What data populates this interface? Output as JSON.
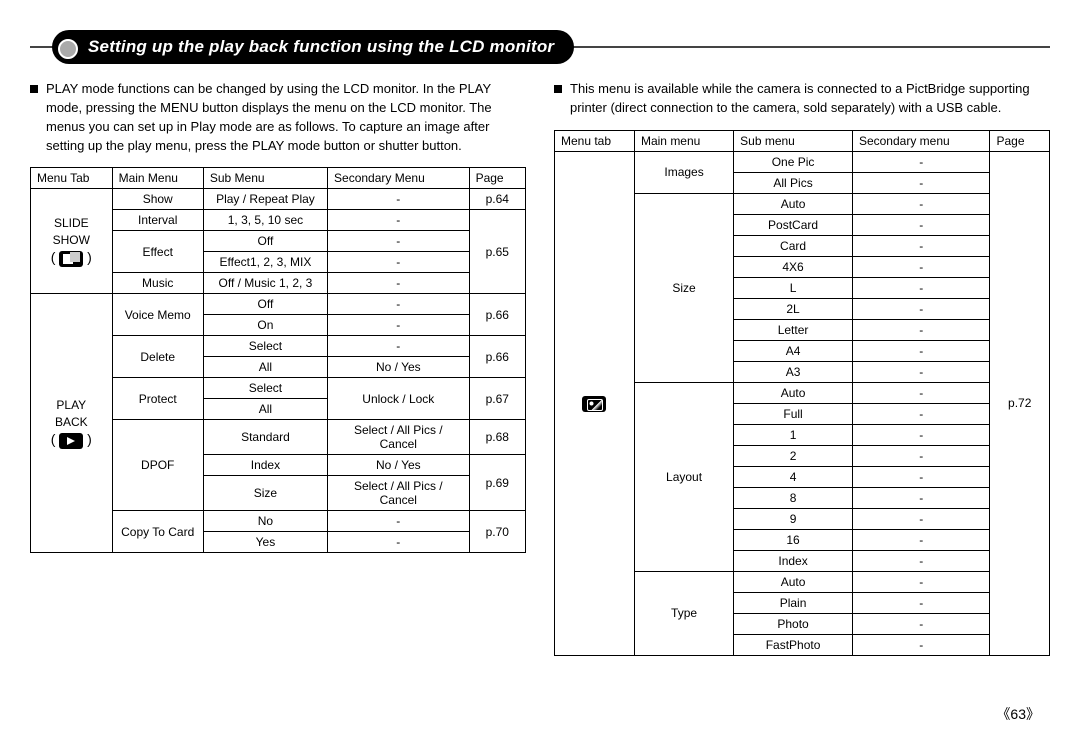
{
  "banner": {
    "title": "Setting up the play back function using the LCD monitor"
  },
  "left": {
    "para": "PLAY mode functions can be changed by using the LCD monitor. In the PLAY mode, pressing the MENU button displays the menu on the LCD monitor. The menus you can set up in Play mode are as follows. To capture an image after setting up the play menu, press the PLAY mode button or shutter button.",
    "headers": [
      "Menu Tab",
      "Main Menu",
      "Sub Menu",
      "Secondary Menu",
      "Page"
    ],
    "groups": [
      {
        "tab": "SLIDE SHOW",
        "icon": "slide",
        "rows": [
          {
            "main": "Show",
            "sub": "Play / Repeat Play",
            "sec": "-",
            "page": "p.64"
          },
          {
            "main": "Interval",
            "sub": "1, 3, 5, 10 sec",
            "sec": "-",
            "page": ""
          },
          {
            "main": "Effect",
            "sub": "Off",
            "sec": "-",
            "page": "p.65"
          },
          {
            "main": "",
            "sub": "Effect1, 2, 3, MIX",
            "sec": "-",
            "page": ""
          },
          {
            "main": "Music",
            "sub": "Off / Music 1, 2, 3",
            "sec": "-",
            "page": ""
          }
        ]
      },
      {
        "tab": "PLAY BACK",
        "icon": "play",
        "rows": [
          {
            "main": "Voice Memo",
            "sub": "Off",
            "sec": "-",
            "page": "p.66"
          },
          {
            "main": "",
            "sub": "On",
            "sec": "-",
            "page": ""
          },
          {
            "main": "Delete",
            "sub": "Select",
            "sec": "-",
            "page": "p.66"
          },
          {
            "main": "",
            "sub": "All",
            "sec": "No / Yes",
            "page": ""
          },
          {
            "main": "Protect",
            "sub": "Select",
            "sec": "Unlock / Lock",
            "page": "p.67"
          },
          {
            "main": "",
            "sub": "All",
            "sec": "",
            "page": ""
          },
          {
            "main": "DPOF",
            "sub": "Standard",
            "sec": "Select / All Pics / Cancel",
            "page": "p.68"
          },
          {
            "main": "",
            "sub": "Index",
            "sec": "No / Yes",
            "page": "p.69"
          },
          {
            "main": "",
            "sub": "Size",
            "sec": "Select / All Pics / Cancel",
            "page": ""
          },
          {
            "main": "Copy To Card",
            "sub": "No",
            "sec": "-",
            "page": "p.70"
          },
          {
            "main": "",
            "sub": "Yes",
            "sec": "-",
            "page": ""
          }
        ]
      }
    ]
  },
  "right": {
    "para": "This menu is available while the camera is connected to a PictBridge supporting printer (direct connection to the camera, sold separately) with a USB cable.",
    "headers": [
      "Menu tab",
      "Main menu",
      "Sub menu",
      "Secondary menu",
      "Page"
    ],
    "tab_icon": "pict",
    "page": "p.72",
    "sections": [
      {
        "main": "Images",
        "rows": [
          {
            "sub": "One Pic",
            "sec": "-"
          },
          {
            "sub": "All Pics",
            "sec": "-"
          }
        ]
      },
      {
        "main": "Size",
        "rows": [
          {
            "sub": "Auto",
            "sec": "-"
          },
          {
            "sub": "PostCard",
            "sec": "-"
          },
          {
            "sub": "Card",
            "sec": "-"
          },
          {
            "sub": "4X6",
            "sec": "-"
          },
          {
            "sub": "L",
            "sec": "-"
          },
          {
            "sub": "2L",
            "sec": "-"
          },
          {
            "sub": "Letter",
            "sec": "-"
          },
          {
            "sub": "A4",
            "sec": "-"
          },
          {
            "sub": "A3",
            "sec": "-"
          }
        ]
      },
      {
        "main": "Layout",
        "rows": [
          {
            "sub": "Auto",
            "sec": "-"
          },
          {
            "sub": "Full",
            "sec": "-"
          },
          {
            "sub": "1",
            "sec": "-"
          },
          {
            "sub": "2",
            "sec": "-"
          },
          {
            "sub": "4",
            "sec": "-"
          },
          {
            "sub": "8",
            "sec": "-"
          },
          {
            "sub": "9",
            "sec": "-"
          },
          {
            "sub": "16",
            "sec": "-"
          },
          {
            "sub": "Index",
            "sec": "-"
          }
        ]
      },
      {
        "main": "Type",
        "rows": [
          {
            "sub": "Auto",
            "sec": "-"
          },
          {
            "sub": "Plain",
            "sec": "-"
          },
          {
            "sub": "Photo",
            "sec": "-"
          },
          {
            "sub": "FastPhoto",
            "sec": "-"
          }
        ]
      }
    ]
  },
  "page_number": "63"
}
